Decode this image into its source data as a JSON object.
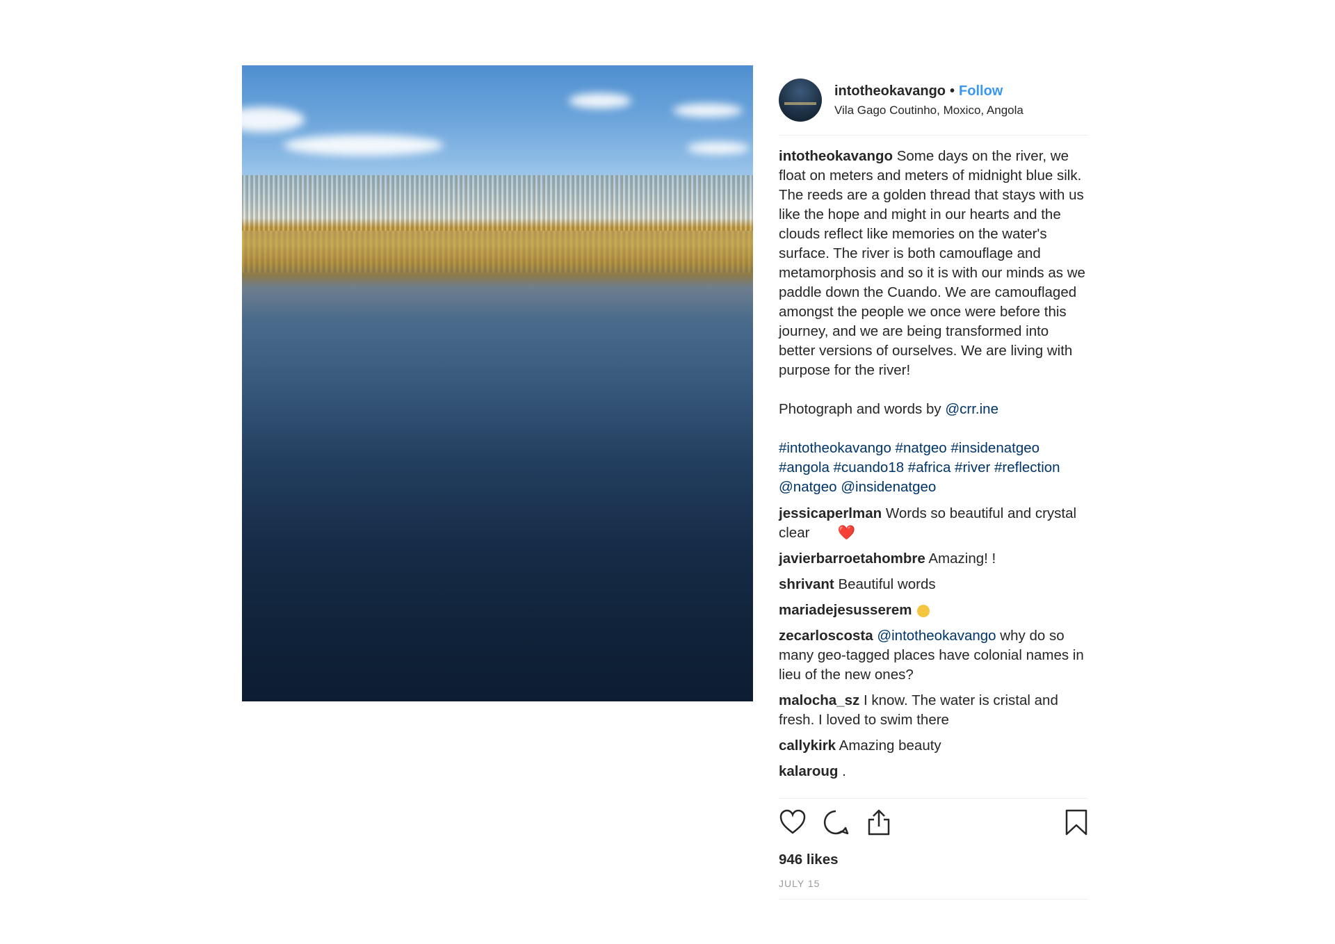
{
  "post": {
    "username": "intotheokavango",
    "follow_label": "Follow",
    "separator": "•",
    "location": "Vila Gago Coutinho, Moxico, Angola",
    "caption_text": "Some days on the river, we float on meters and meters of midnight blue silk. The reeds are a golden thread that stays with us like the hope and might in our hearts and the clouds reflect like memories on the water's surface. The river is both camouflage and metamorphosis and so it is with our minds as we paddle down the Cuando. We are camouflaged amongst the people we once were before this journey, and we are being transformed into better versions of ourselves. We are living with purpose for the river!",
    "credit_prefix": "Photograph and words by",
    "credit_link": "@crr.ine",
    "tags": "#intotheokavango #natgeo #insidenatgeo #angola #cuando18 #africa #river #reflection @natgeo @insidenatgeo"
  },
  "comments": [
    {
      "user": "jessicaperlman",
      "text": "Words so beautiful and crystal clear",
      "emoji": "❤️"
    },
    {
      "user": "javierbarroetahombre",
      "text": "Amazing! !"
    },
    {
      "user": "shrivant",
      "text": "Beautiful words"
    },
    {
      "user": "mariadejesusserem",
      "text": ""
    },
    {
      "user": "zecarloscosta",
      "mention": "@intotheokavango",
      "text": "why do so many geo-tagged places have colonial names in lieu of the new ones?"
    },
    {
      "user": "malocha_sz",
      "text": "I know. The water is cristal and fresh. I loved to swim there"
    },
    {
      "user": "callykirk",
      "text": "Amazing beauty"
    },
    {
      "user": "kalaroug",
      "text": "."
    }
  ],
  "stats": {
    "likes": "946 likes",
    "date": "JULY 15"
  },
  "icons": [
    "heart-icon",
    "comment-icon",
    "share-icon",
    "bookmark-icon"
  ]
}
